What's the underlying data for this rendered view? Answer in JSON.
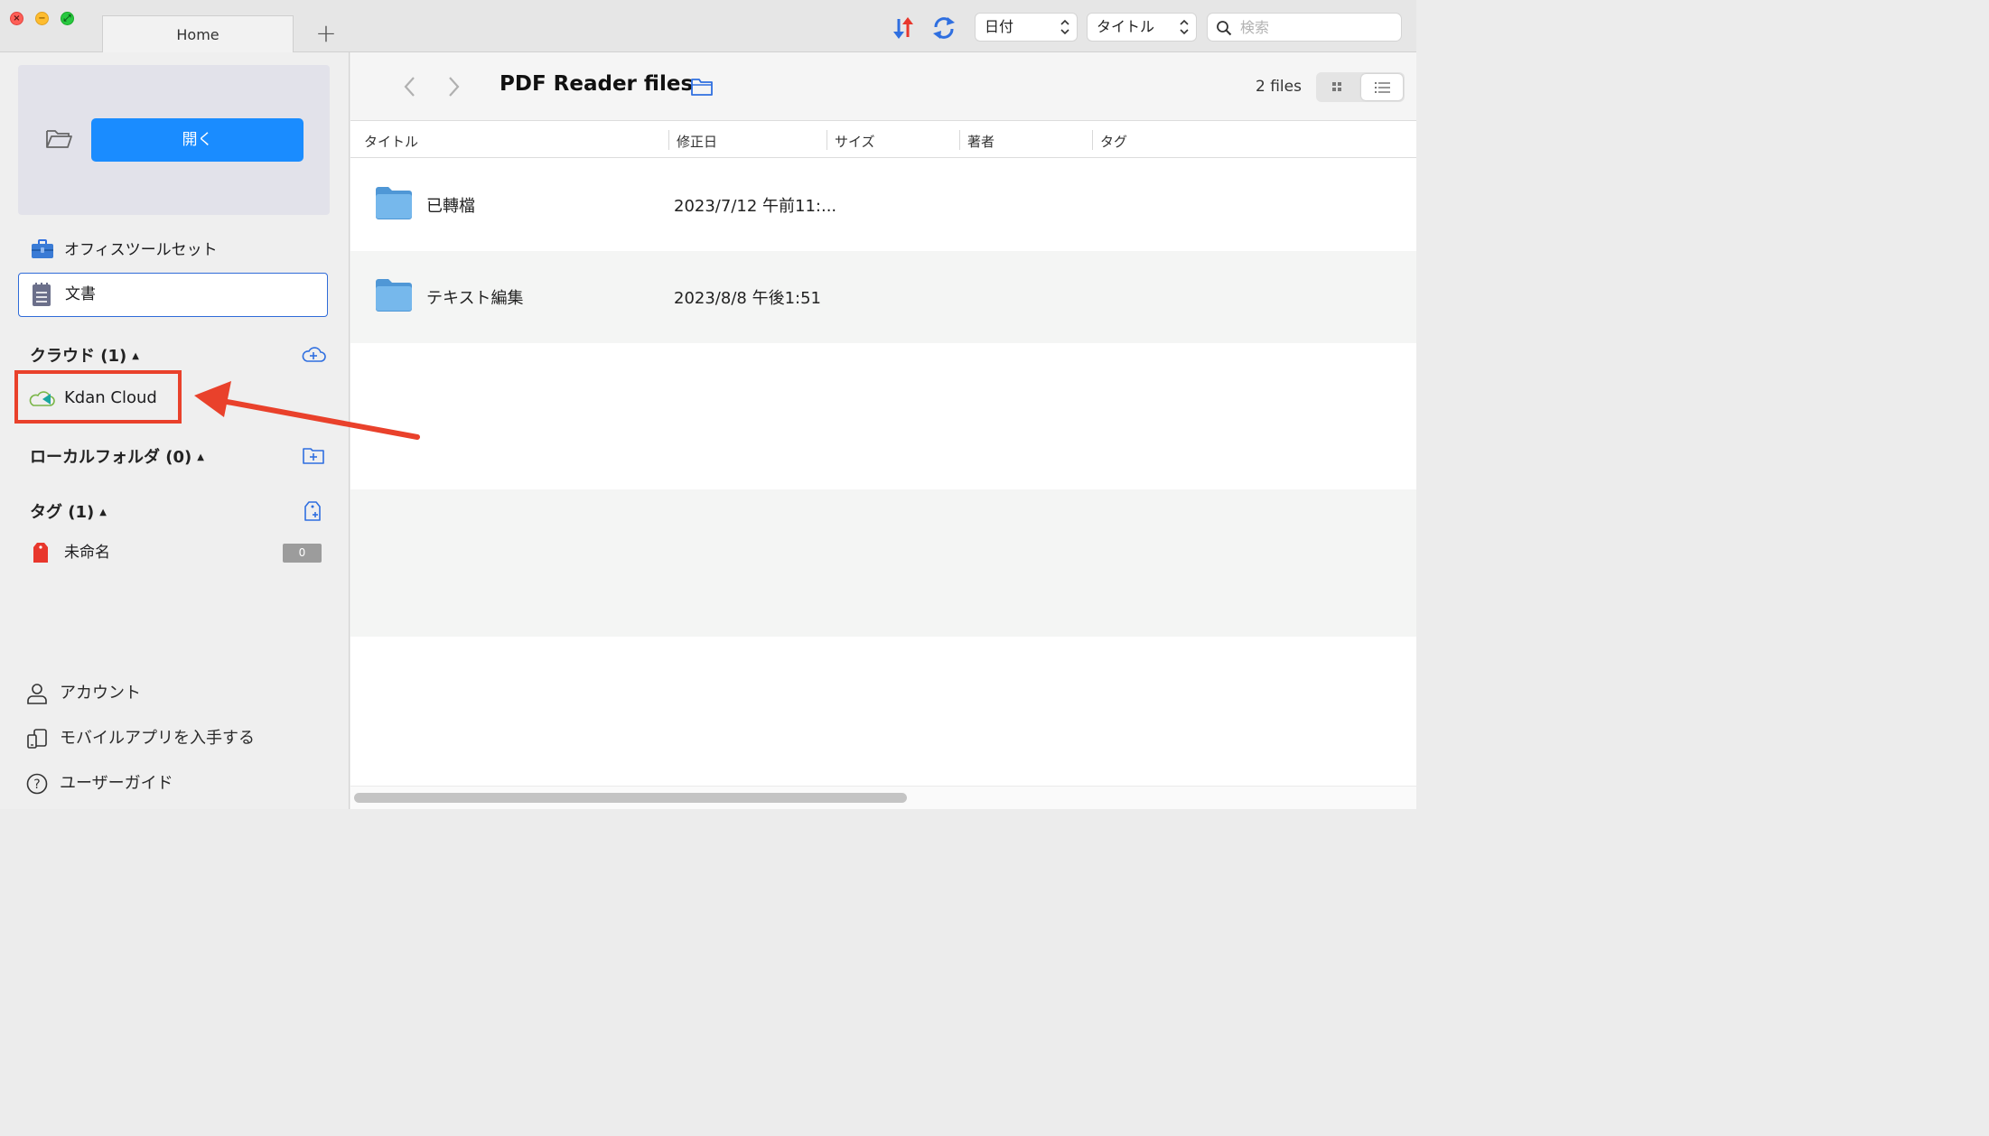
{
  "tabs": [
    {
      "label": "Home"
    }
  ],
  "toolbar": {
    "sort_select": "日付",
    "order_select": "タイトル",
    "search_placeholder": "検索"
  },
  "sidebar": {
    "open_button": "開く",
    "nav": [
      {
        "label": "オフィスツールセット",
        "icon": "toolbox-icon"
      },
      {
        "label": "文書",
        "icon": "notepad-icon",
        "selected": true
      }
    ],
    "cloud": {
      "title": "クラウド (1)",
      "items": [
        {
          "label": "Kdan Cloud",
          "icon": "kdan-cloud-icon"
        }
      ]
    },
    "local": {
      "title": "ローカルフォルダ (0)"
    },
    "tags": {
      "title": "タグ (1)",
      "items": [
        {
          "label": "未命名",
          "count": "0",
          "color": "#e8372c"
        }
      ]
    },
    "bottom": [
      {
        "label": "アカウント",
        "icon": "person-icon"
      },
      {
        "label": "モバイルアプリを入手する",
        "icon": "mobile-app-icon"
      },
      {
        "label": "ユーザーガイド",
        "icon": "help-icon"
      }
    ]
  },
  "main": {
    "title": "PDF Reader files",
    "file_count": "2 files",
    "columns": [
      "タイトル",
      "修正日",
      "サイズ",
      "著者",
      "タグ"
    ],
    "files": [
      {
        "name": "已轉檔",
        "modified": "2023/7/12 午前11:..."
      },
      {
        "name": "テキスト編集",
        "modified": "2023/8/8 午後1:51"
      }
    ]
  },
  "colors": {
    "accent": "#1a8cff",
    "highlight": "#e9412b",
    "selection_border": "#2f6bd8",
    "folder": "#5ba7e3"
  }
}
